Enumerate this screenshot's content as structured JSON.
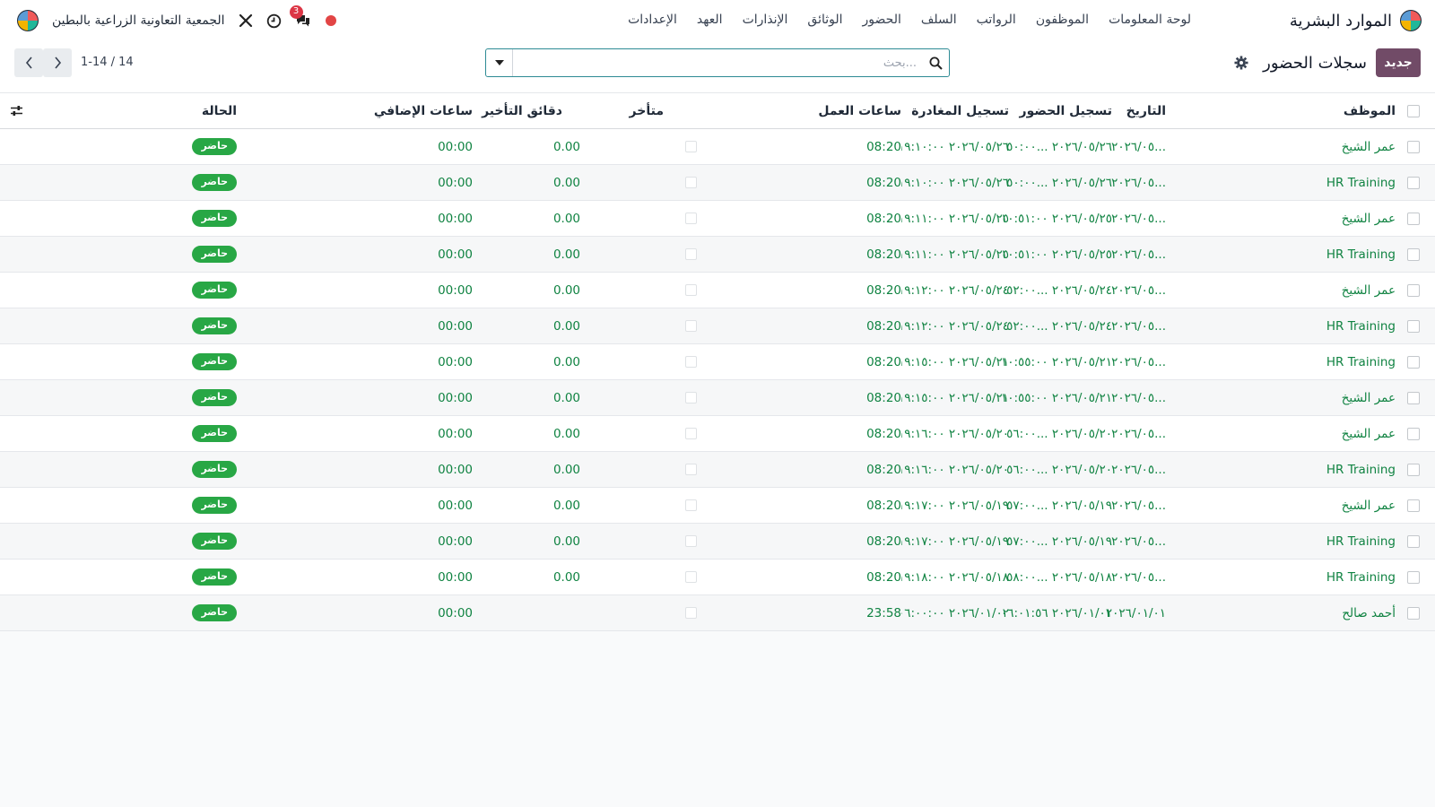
{
  "topbar": {
    "app_title": "الموارد البشرية",
    "menu": [
      "لوحة المعلومات",
      "الموظفون",
      "الرواتب",
      "السلف",
      "الحضور",
      "الوثائق",
      "الإنذارات",
      "العهد",
      "الإعدادات"
    ],
    "company_name": "الجمعية التعاونية الزراعية بالبطين",
    "chat_badge": "3"
  },
  "control": {
    "new_button": "جديد",
    "page_title": "سجلات الحضور",
    "search_placeholder": "...بحث",
    "pager": "1-14 / 14"
  },
  "table": {
    "headers": {
      "employee": "الموظف",
      "date": "التاريخ",
      "check_in": "تسجيل الحضور",
      "check_out": "تسجيل المغادرة",
      "work_hours": "ساعات العمل",
      "late": "متأخر",
      "delay_minutes": "دقائق التأخير",
      "overtime_hours": "ساعات الإضافي",
      "status": "الحالة"
    },
    "rows": [
      {
        "employee": "عمر الشيخ",
        "date": "٢٠٢٦/٠٥...",
        "check_in": "٢٠٢٦/٠٥/٢٦ ...٥٠:٠٠",
        "check_out": "٢٠٢٦/٠٥/٢٦ ١٩:١٠:٠٠",
        "work_hours": "08:20",
        "delay": "0.00",
        "overtime": "00:00",
        "status": "حاضر"
      },
      {
        "employee": "HR Training",
        "date": "٢٠٢٦/٠٥...",
        "check_in": "٢٠٢٦/٠٥/٢٦ ...٥٠:٠٠",
        "check_out": "٢٠٢٦/٠٥/٢٦ ١٩:١٠:٠٠",
        "work_hours": "08:20",
        "delay": "0.00",
        "overtime": "00:00",
        "status": "حاضر"
      },
      {
        "employee": "عمر الشيخ",
        "date": "٢٠٢٦/٠٥...",
        "check_in": "٢٠٢٦/٠٥/٢٥ ١٠:٥١:٠٠",
        "check_out": "٢٠٢٦/٠٥/٢٥ ١٩:١١:٠٠",
        "work_hours": "08:20",
        "delay": "0.00",
        "overtime": "00:00",
        "status": "حاضر"
      },
      {
        "employee": "HR Training",
        "date": "٢٠٢٦/٠٥...",
        "check_in": "٢٠٢٦/٠٥/٢٥ ١٠:٥١:٠٠",
        "check_out": "٢٠٢٦/٠٥/٢٥ ١٩:١١:٠٠",
        "work_hours": "08:20",
        "delay": "0.00",
        "overtime": "00:00",
        "status": "حاضر"
      },
      {
        "employee": "عمر الشيخ",
        "date": "٢٠٢٦/٠٥...",
        "check_in": "٢٠٢٦/٠٥/٢٤ ...٥٢:٠٠",
        "check_out": "٢٠٢٦/٠٥/٢٤ ١٩:١٢:٠٠",
        "work_hours": "08:20",
        "delay": "0.00",
        "overtime": "00:00",
        "status": "حاضر"
      },
      {
        "employee": "HR Training",
        "date": "٢٠٢٦/٠٥...",
        "check_in": "٢٠٢٦/٠٥/٢٤ ...٥٢:٠٠",
        "check_out": "٢٠٢٦/٠٥/٢٤ ١٩:١٢:٠٠",
        "work_hours": "08:20",
        "delay": "0.00",
        "overtime": "00:00",
        "status": "حاضر"
      },
      {
        "employee": "HR Training",
        "date": "٢٠٢٦/٠٥...",
        "check_in": "٢٠٢٦/٠٥/٢١ ١٠:٥٥:٠٠",
        "check_out": "٢٠٢٦/٠٥/٢١ ١٩:١٥:٠٠",
        "work_hours": "08:20",
        "delay": "0.00",
        "overtime": "00:00",
        "status": "حاضر"
      },
      {
        "employee": "عمر الشيخ",
        "date": "٢٠٢٦/٠٥...",
        "check_in": "٢٠٢٦/٠٥/٢١ ١٠:٥٥:٠٠",
        "check_out": "٢٠٢٦/٠٥/٢١ ١٩:١٥:٠٠",
        "work_hours": "08:20",
        "delay": "0.00",
        "overtime": "00:00",
        "status": "حاضر"
      },
      {
        "employee": "عمر الشيخ",
        "date": "٢٠٢٦/٠٥...",
        "check_in": "٢٠٢٦/٠٥/٢٠ ...٥٦:٠٠",
        "check_out": "٢٠٢٦/٠٥/٢٠ ١٩:١٦:٠٠",
        "work_hours": "08:20",
        "delay": "0.00",
        "overtime": "00:00",
        "status": "حاضر"
      },
      {
        "employee": "HR Training",
        "date": "٢٠٢٦/٠٥...",
        "check_in": "٢٠٢٦/٠٥/٢٠ ...٥٦:٠٠",
        "check_out": "٢٠٢٦/٠٥/٢٠ ١٩:١٦:٠٠",
        "work_hours": "08:20",
        "delay": "0.00",
        "overtime": "00:00",
        "status": "حاضر"
      },
      {
        "employee": "عمر الشيخ",
        "date": "٢٠٢٦/٠٥...",
        "check_in": "٢٠٢٦/٠٥/١٩ ...٥٧:٠٠",
        "check_out": "٢٠٢٦/٠٥/١٩ ١٩:١٧:٠٠",
        "work_hours": "08:20",
        "delay": "0.00",
        "overtime": "00:00",
        "status": "حاضر"
      },
      {
        "employee": "HR Training",
        "date": "٢٠٢٦/٠٥...",
        "check_in": "٢٠٢٦/٠٥/١٩ ...٥٧:٠٠",
        "check_out": "٢٠٢٦/٠٥/١٩ ١٩:١٧:٠٠",
        "work_hours": "08:20",
        "delay": "0.00",
        "overtime": "00:00",
        "status": "حاضر"
      },
      {
        "employee": "HR Training",
        "date": "٢٠٢٦/٠٥...",
        "check_in": "٢٠٢٦/٠٥/١٨ ...٥٨:٠٠",
        "check_out": "٢٠٢٦/٠٥/١٨ ١٩:١٨:٠٠",
        "work_hours": "08:20",
        "delay": "0.00",
        "overtime": "00:00",
        "status": "حاضر"
      },
      {
        "employee": "أحمد صالح",
        "date": "٢٠٢٦/٠١/٠١",
        "check_in": "٢٠٢٦/٠١/٠١ ٠٦:٠١:٥٦",
        "check_out": "٢٠٢٦/٠١/٠٢ ٠٦:٠٠:٠٠",
        "work_hours": "23:58",
        "delay": "",
        "overtime": "00:00",
        "status": "حاضر"
      }
    ]
  },
  "colors": {
    "brand": "#714b67",
    "green_text": "#108342",
    "status_badge": "#28a745",
    "notification": "#dc3545"
  }
}
